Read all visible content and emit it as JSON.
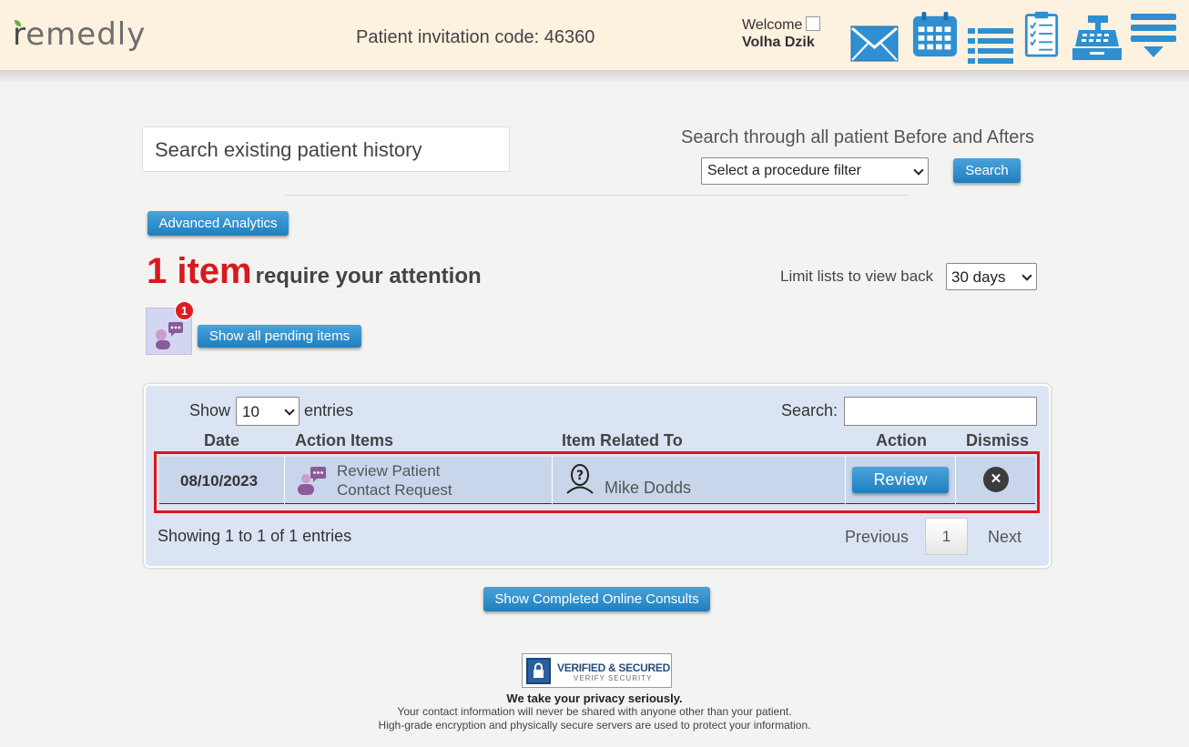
{
  "header": {
    "logo": "remedly",
    "invitation_label": "Patient invitation code: 46360",
    "welcome": "Welcome",
    "user_name": "Volha Dzik"
  },
  "search": {
    "placeholder": "Search existing patient history",
    "before_after_label": "Search through all patient Before and Afters",
    "procedure_filter": "Select a procedure filter",
    "search_button": "Search"
  },
  "analytics_button": "Advanced Analytics",
  "attention": {
    "count": "1 item",
    "text": "require your attention",
    "limit_label": "Limit lists to view back",
    "limit_value": "30 days"
  },
  "pending": {
    "badge": "1",
    "button": "Show all pending items"
  },
  "table": {
    "show_label": "Show",
    "entries_value": "10",
    "entries_label": "entries",
    "search_label": "Search:",
    "columns": [
      "Date",
      "Action Items",
      "Item Related To",
      "Action",
      "Dismiss"
    ],
    "rows": [
      {
        "date": "08/10/2023",
        "action_line1": "Review Patient",
        "action_line2": "Contact Request",
        "related_to": "Mike Dodds",
        "action_button": "Review",
        "dismiss": "✕"
      }
    ],
    "showing": "Showing 1 to 1 of 1 entries",
    "previous": "Previous",
    "page": "1",
    "next": "Next"
  },
  "completed_button": "Show Completed Online Consults",
  "footer": {
    "badge_line1": "VERIFIED & SECURED",
    "badge_line2": "VERIFY SECURITY",
    "title": "We take your privacy seriously.",
    "line1": "Your contact information will never be shared with anyone other than your patient.",
    "line2": "High-grade encryption and physically secure servers are used to protect your information."
  },
  "colors": {
    "accent_blue": "#1f7fbf",
    "alert_red": "#d71920",
    "header_bg": "#fdf1e0",
    "panel_bg": "#dbe4f3"
  },
  "icons": {
    "header": [
      "mail-icon",
      "calendar-icon",
      "list-icon",
      "checklist-icon",
      "cash-register-icon",
      "menu-icon"
    ]
  }
}
